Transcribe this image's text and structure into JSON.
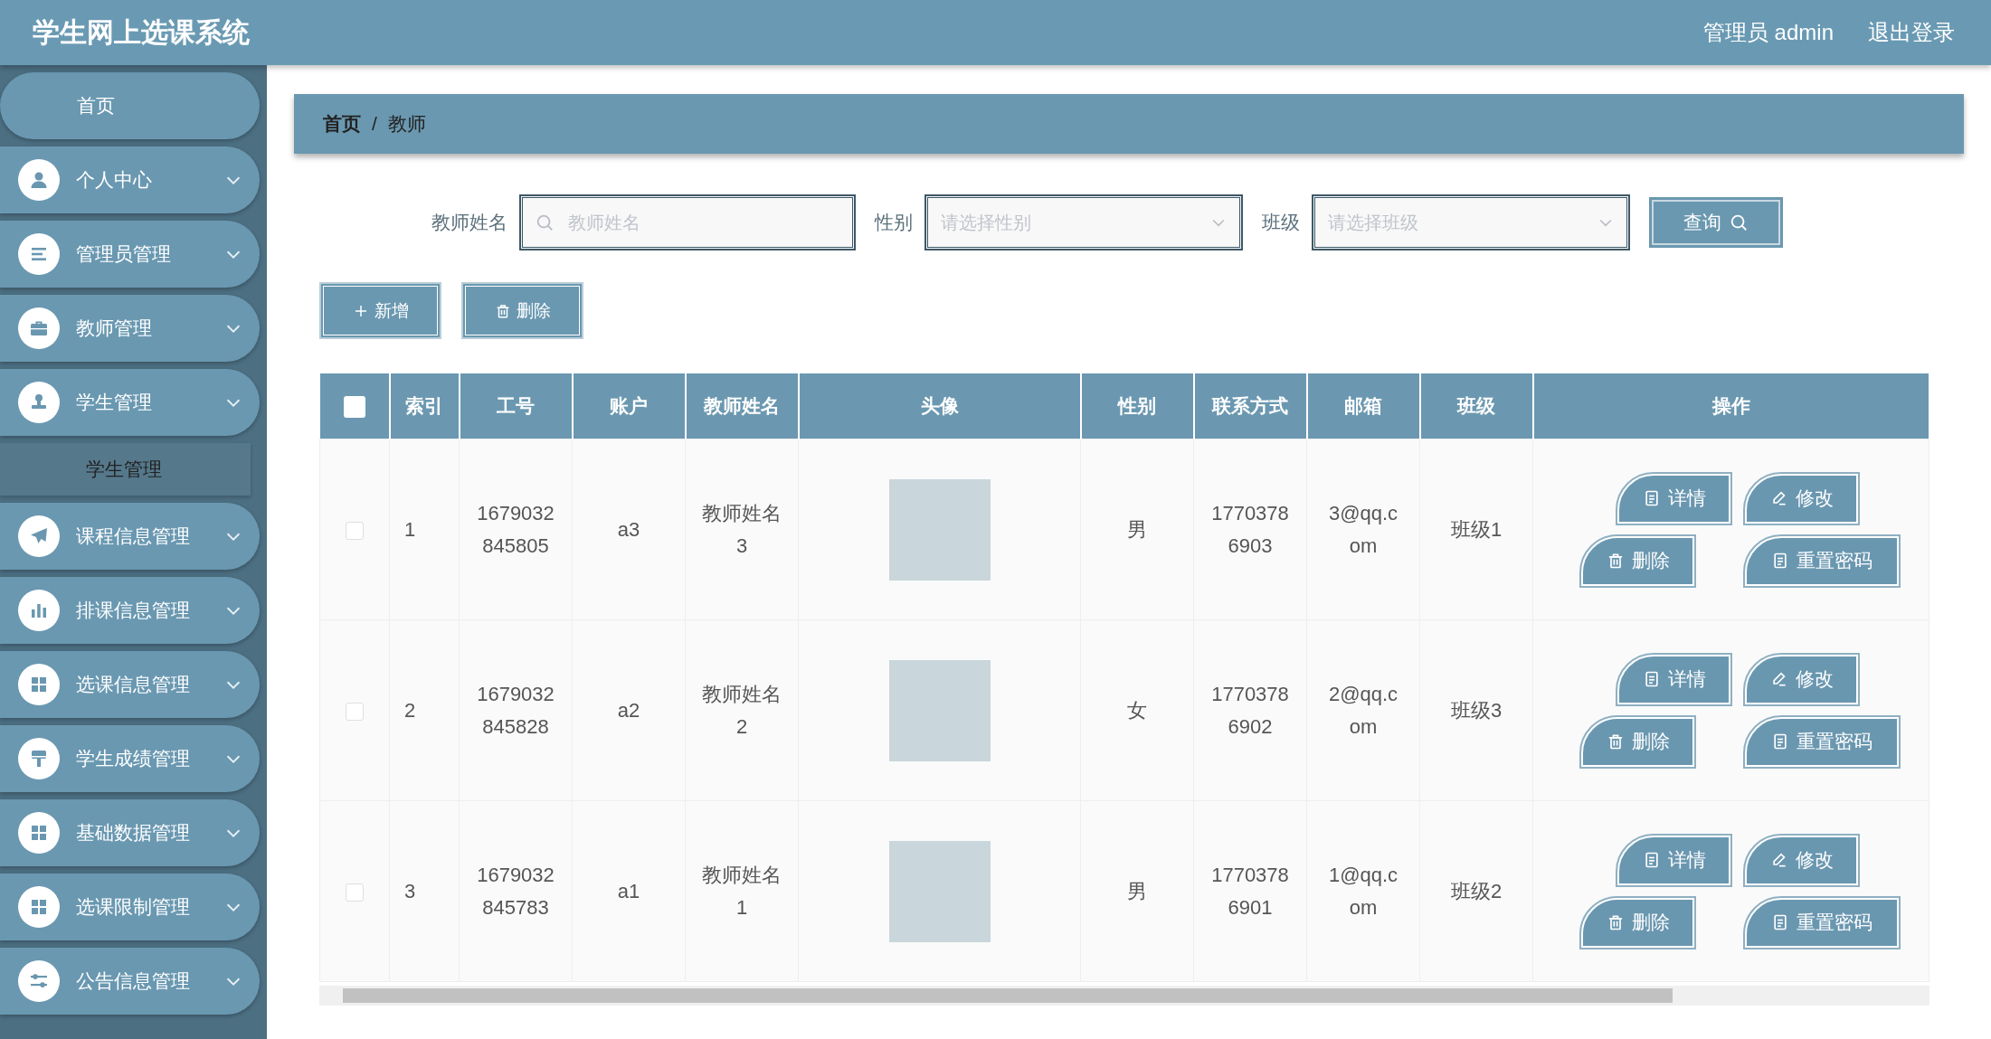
{
  "header": {
    "title": "学生网上选课系统",
    "user": "管理员 admin",
    "logout": "退出登录"
  },
  "sidebar": {
    "items": [
      {
        "kind": "link",
        "label": "首页"
      },
      {
        "kind": "menu",
        "label": "个人中心"
      },
      {
        "kind": "menu",
        "label": "管理员管理"
      },
      {
        "kind": "menu",
        "label": "教师管理"
      },
      {
        "kind": "menu",
        "label": "学生管理",
        "children": [
          {
            "label": "学生管理"
          }
        ]
      },
      {
        "kind": "menu",
        "label": "课程信息管理"
      },
      {
        "kind": "menu",
        "label": "排课信息管理"
      },
      {
        "kind": "menu",
        "label": "选课信息管理"
      },
      {
        "kind": "menu",
        "label": "学生成绩管理"
      },
      {
        "kind": "menu",
        "label": "基础数据管理"
      },
      {
        "kind": "menu",
        "label": "选课限制管理"
      },
      {
        "kind": "menu",
        "label": "公告信息管理"
      }
    ]
  },
  "breadcrumb": {
    "items": [
      "首页",
      "教师"
    ],
    "separator": "/"
  },
  "search": {
    "fields": [
      {
        "kind": "text",
        "label": "教师姓名",
        "placeholder": "教师姓名"
      },
      {
        "kind": "select",
        "label": "性别",
        "placeholder": "请选择性别"
      },
      {
        "kind": "select",
        "label": "班级",
        "placeholder": "请选择班级"
      }
    ],
    "button": "查询"
  },
  "toolbar": [
    {
      "kind": "add",
      "label": "新增"
    },
    {
      "kind": "delete",
      "label": "删除"
    }
  ],
  "table": {
    "select_all_checked": false,
    "columns": [
      "索引",
      "工号",
      "账户",
      "教师姓名",
      "头像",
      "性别",
      "联系方式",
      "邮箱",
      "班级",
      "操作"
    ],
    "rows": [
      {
        "checked": false,
        "index": "1",
        "id": "1679032845805",
        "account": "a3",
        "name": "教师姓名3",
        "gender": "男",
        "phone": "17703786903",
        "email": "3@qq.com",
        "class": "班级1",
        "actions": [
          {
            "kind": "detail",
            "label": "详情"
          },
          {
            "kind": "edit",
            "label": "修改"
          },
          {
            "kind": "delete",
            "label": "删除"
          },
          {
            "kind": "reset",
            "label": "重置密码"
          }
        ]
      },
      {
        "checked": false,
        "index": "2",
        "id": "1679032845828",
        "account": "a2",
        "name": "教师姓名2",
        "gender": "女",
        "phone": "17703786902",
        "email": "2@qq.com",
        "class": "班级3",
        "actions": [
          {
            "kind": "detail",
            "label": "详情"
          },
          {
            "kind": "edit",
            "label": "修改"
          },
          {
            "kind": "delete",
            "label": "删除"
          },
          {
            "kind": "reset",
            "label": "重置密码"
          }
        ]
      },
      {
        "checked": false,
        "index": "3",
        "id": "1679032845783",
        "account": "a1",
        "name": "教师姓名1",
        "gender": "男",
        "phone": "17703786901",
        "email": "1@qq.com",
        "class": "班级2",
        "actions": [
          {
            "kind": "detail",
            "label": "详情"
          },
          {
            "kind": "edit",
            "label": "修改"
          },
          {
            "kind": "delete",
            "label": "删除"
          },
          {
            "kind": "reset",
            "label": "重置密码"
          }
        ]
      }
    ]
  }
}
